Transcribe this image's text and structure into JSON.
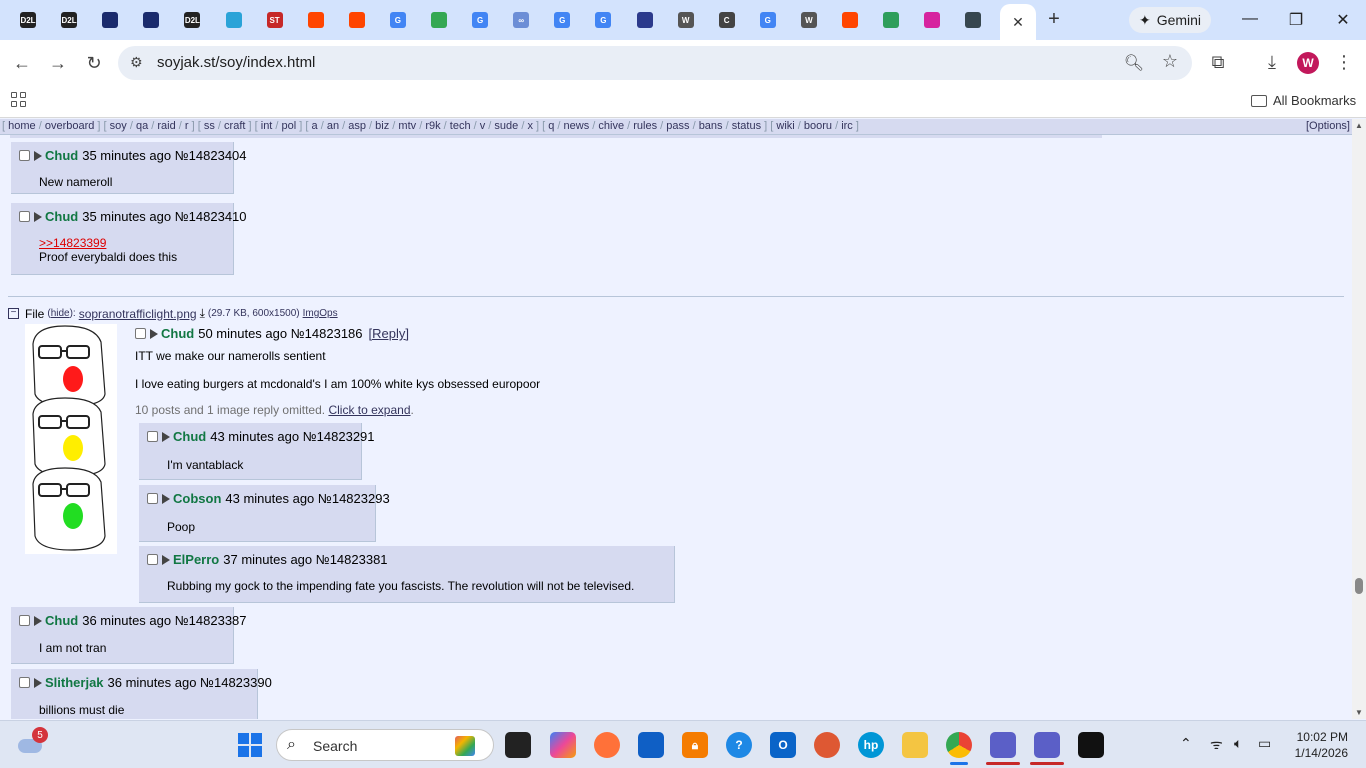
{
  "browser": {
    "tabs": [
      {
        "label": "D2L",
        "color": "#222222"
      },
      {
        "label": "D2L",
        "color": "#222222"
      },
      {
        "label": "",
        "color": "#1a2b6d"
      },
      {
        "label": "",
        "color": "#1a2b6d"
      },
      {
        "label": "D2L",
        "color": "#222222"
      },
      {
        "label": "",
        "color": "#2aa3d8"
      },
      {
        "label": "ST",
        "color": "#c62828"
      },
      {
        "label": "",
        "color": "#ff4500"
      },
      {
        "label": "",
        "color": "#ff4500"
      },
      {
        "label": "G",
        "color": "#4285f4"
      },
      {
        "label": "",
        "color": "#34a853"
      },
      {
        "label": "G",
        "color": "#4285f4"
      },
      {
        "label": "∞",
        "color": "#6c8ed6"
      },
      {
        "label": "G",
        "color": "#4285f4"
      },
      {
        "label": "G",
        "color": "#4285f4"
      },
      {
        "label": "",
        "color": "#2b3a8c"
      },
      {
        "label": "W",
        "color": "#555555"
      },
      {
        "label": "C",
        "color": "#444444"
      },
      {
        "label": "G",
        "color": "#4285f4"
      },
      {
        "label": "W",
        "color": "#555555"
      },
      {
        "label": "",
        "color": "#ff4500"
      },
      {
        "label": "",
        "color": "#2e9e5b"
      },
      {
        "label": "",
        "color": "#d6249f"
      },
      {
        "label": "",
        "color": "#37474f"
      }
    ],
    "active_tab_close": "✕",
    "new_tab": "+",
    "gemini_label": "Gemini",
    "url": "soyjak.st/soy/index.html",
    "all_bookmarks": "All Bookmarks",
    "profile_initial": "W"
  },
  "boardlist": {
    "groups": [
      [
        "home",
        "overboard"
      ],
      [
        "soy",
        "qa",
        "raid",
        "r"
      ],
      [
        "ss",
        "craft"
      ],
      [
        "int",
        "pol"
      ],
      [
        "a",
        "an",
        "asp",
        "biz",
        "mtv",
        "r9k",
        "tech",
        "v",
        "sude",
        "x"
      ],
      [
        "q",
        "news",
        "chive",
        "rules",
        "pass",
        "bans",
        "status"
      ],
      [
        "wiki",
        "booru",
        "irc"
      ]
    ],
    "options": "[Options]"
  },
  "posts_top": [
    {
      "name": "Chud",
      "meta": "35 minutes ago №14823404",
      "lines": [
        "New nameroll"
      ]
    },
    {
      "name": "Chud",
      "meta": "35 minutes ago №14823410",
      "quote": ">>14823399",
      "lines": [
        "Proof everybaldi does this"
      ]
    }
  ],
  "thread": {
    "file_label": "File",
    "hide": "hide",
    "filename": "sopranotrafficlight.png",
    "filesize": "(29.7 KB, 600x1500)",
    "imgops": "ImgOps",
    "op": {
      "name": "Chud",
      "meta": "50 minutes ago №14823186",
      "reply_link": "[Reply]",
      "subject": "ITT we make our namerolls sentient",
      "text": "I love eating burgers at mcdonald's I am 100% white kys obsessed europoor"
    },
    "omitted_text": "10 posts and 1 image reply omitted.",
    "expand_link": "Click to expand",
    "replies": [
      {
        "name": "Chud",
        "meta": "43 minutes ago №14823291",
        "text": "I'm vantablack"
      },
      {
        "name": "Cobson",
        "meta": "43 minutes ago №14823293",
        "text": "Poop"
      },
      {
        "name": "ElPerro",
        "meta": "37 minutes ago №14823381",
        "text": "Rubbing my gock to the impending fate you fascists. The revolution will not be televised."
      }
    ]
  },
  "posts_bottom": [
    {
      "name": "Chud",
      "meta": "36 minutes ago №14823387",
      "text": "I am not tran"
    },
    {
      "name": "Slitherjak",
      "meta": "36 minutes ago №14823390",
      "text": "billions must die"
    }
  ],
  "taskbar": {
    "weather_badge": "5",
    "search_placeholder": "Search",
    "time": "10:02 PM",
    "date": "1/14/2026"
  }
}
